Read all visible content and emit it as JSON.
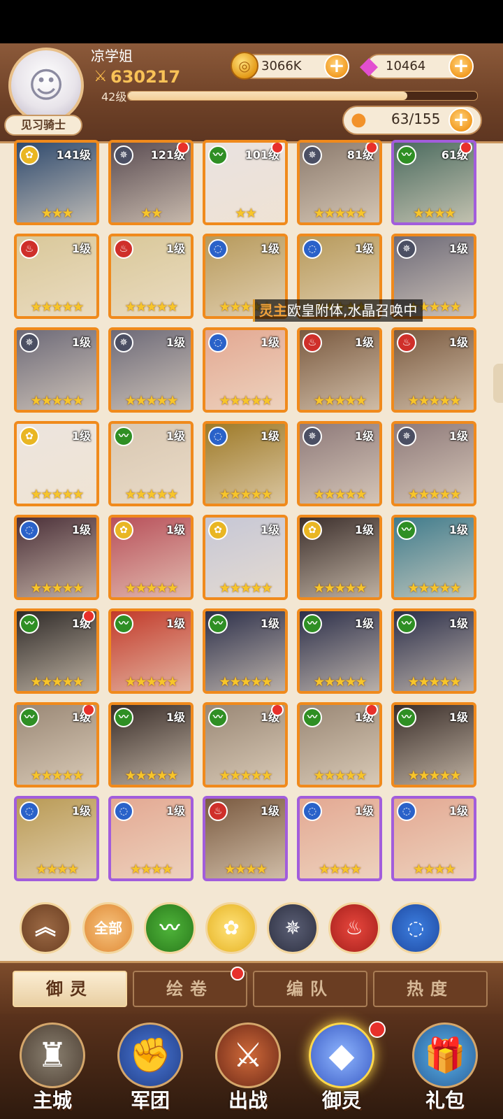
{
  "player": {
    "name": "凉学姐",
    "power": "630217",
    "level": "42级",
    "xp_fraction": 0.8,
    "rank": "见习骑士"
  },
  "resources": {
    "gold": "3066K",
    "crystals": "10464",
    "capacity": "63/155"
  },
  "element_colors": {
    "gold": "#e9b623",
    "star": "#4b4f63",
    "wind": "#2f8f24",
    "fire": "#cf2f2a",
    "water": "#2a62c9"
  },
  "heroes": [
    {
      "elem": "gold",
      "level": "141级",
      "stars": "★★★",
      "dot": false,
      "frame": "orange",
      "color": "#2f4a6e"
    },
    {
      "elem": "star",
      "level": "121级",
      "stars": "★★",
      "dot": true,
      "frame": "orange",
      "color": "#5a4c52"
    },
    {
      "elem": "wind",
      "level": "101级",
      "stars": "★★",
      "dot": true,
      "frame": "orange",
      "color": "#e9e2e0"
    },
    {
      "elem": "star",
      "level": "81级",
      "stars": "★★★★★",
      "dot": true,
      "frame": "orange",
      "color": "#8c7b6e"
    },
    {
      "elem": "wind",
      "level": "61级",
      "stars": "★★★★",
      "dot": true,
      "frame": "purple",
      "color": "#4b6b5f"
    },
    {
      "elem": "fire",
      "level": "1级",
      "stars": "★★★★★",
      "dot": false,
      "frame": "orange",
      "color": "#d9c89a"
    },
    {
      "elem": "fire",
      "level": "1级",
      "stars": "★★★★★",
      "dot": false,
      "frame": "orange",
      "color": "#d9c89a"
    },
    {
      "elem": "water",
      "level": "1级",
      "stars": "★★★★★",
      "dot": false,
      "frame": "orange",
      "color": "#b79a5c"
    },
    {
      "elem": "water",
      "level": "1级",
      "stars": "★★★★★",
      "dot": false,
      "frame": "orange",
      "color": "#b79a5c"
    },
    {
      "elem": "star",
      "level": "1级",
      "stars": "★★★★★",
      "dot": false,
      "frame": "orange",
      "color": "#6d6a78"
    },
    {
      "elem": "star",
      "level": "1级",
      "stars": "★★★★★",
      "dot": false,
      "frame": "orange",
      "color": "#6d6a78"
    },
    {
      "elem": "star",
      "level": "1级",
      "stars": "★★★★★",
      "dot": false,
      "frame": "orange",
      "color": "#6d6a78"
    },
    {
      "elem": "water",
      "level": "1级",
      "stars": "★★★★★",
      "dot": false,
      "frame": "orange",
      "color": "#e3a892"
    },
    {
      "elem": "fire",
      "level": "1级",
      "stars": "★★★★★",
      "dot": false,
      "frame": "orange",
      "color": "#7a5a40"
    },
    {
      "elem": "fire",
      "level": "1级",
      "stars": "★★★★★",
      "dot": false,
      "frame": "orange",
      "color": "#7a5a40"
    },
    {
      "elem": "gold",
      "level": "1级",
      "stars": "★★★★★",
      "dot": false,
      "frame": "orange",
      "color": "#ece4de"
    },
    {
      "elem": "wind",
      "level": "1级",
      "stars": "★★★★★",
      "dot": false,
      "frame": "orange",
      "color": "#d8c7b2"
    },
    {
      "elem": "water",
      "level": "1级",
      "stars": "★★★★★",
      "dot": false,
      "frame": "orange",
      "color": "#9e7a28"
    },
    {
      "elem": "star",
      "level": "1级",
      "stars": "★★★★★",
      "dot": false,
      "frame": "orange",
      "color": "#8e7a7a"
    },
    {
      "elem": "star",
      "level": "1级",
      "stars": "★★★★★",
      "dot": false,
      "frame": "orange",
      "color": "#8e7a7a"
    },
    {
      "elem": "water",
      "level": "1级",
      "stars": "★★★★★",
      "dot": false,
      "frame": "orange",
      "color": "#4a2f38"
    },
    {
      "elem": "gold",
      "level": "1级",
      "stars": "★★★★★",
      "dot": false,
      "frame": "orange",
      "color": "#b8505a"
    },
    {
      "elem": "gold",
      "level": "1级",
      "stars": "★★★★★",
      "dot": false,
      "frame": "orange",
      "color": "#c6c7d6"
    },
    {
      "elem": "gold",
      "level": "1级",
      "stars": "★★★★★",
      "dot": false,
      "frame": "orange",
      "color": "#3c2f2c"
    },
    {
      "elem": "wind",
      "level": "1级",
      "stars": "★★★★★",
      "dot": false,
      "frame": "orange",
      "color": "#3f7b8c"
    },
    {
      "elem": "wind",
      "level": "1级",
      "stars": "★★★★★",
      "dot": true,
      "frame": "orange",
      "color": "#2f2a28"
    },
    {
      "elem": "wind",
      "level": "1级",
      "stars": "★★★★★",
      "dot": false,
      "frame": "orange",
      "color": "#c23a2a"
    },
    {
      "elem": "wind",
      "level": "1级",
      "stars": "★★★★★",
      "dot": false,
      "frame": "orange",
      "color": "#2c2f4a"
    },
    {
      "elem": "wind",
      "level": "1级",
      "stars": "★★★★★",
      "dot": false,
      "frame": "orange",
      "color": "#2c2f4a"
    },
    {
      "elem": "wind",
      "level": "1级",
      "stars": "★★★★★",
      "dot": false,
      "frame": "orange",
      "color": "#2c2f4a"
    },
    {
      "elem": "wind",
      "level": "1级",
      "stars": "★★★★★",
      "dot": true,
      "frame": "orange",
      "color": "#9a8876"
    },
    {
      "elem": "wind",
      "level": "1级",
      "stars": "★★★★★",
      "dot": false,
      "frame": "orange",
      "color": "#3a2e2a"
    },
    {
      "elem": "wind",
      "level": "1级",
      "stars": "★★★★★",
      "dot": true,
      "frame": "orange",
      "color": "#9a8876"
    },
    {
      "elem": "wind",
      "level": "1级",
      "stars": "★★★★★",
      "dot": true,
      "frame": "orange",
      "color": "#9a8876"
    },
    {
      "elem": "wind",
      "level": "1级",
      "stars": "★★★★★",
      "dot": false,
      "frame": "orange",
      "color": "#3a2e2a"
    },
    {
      "elem": "water",
      "level": "1级",
      "stars": "★★★★",
      "dot": false,
      "frame": "purple",
      "color": "#b99a55"
    },
    {
      "elem": "water",
      "level": "1级",
      "stars": "★★★★",
      "dot": false,
      "frame": "purple",
      "color": "#e3a892"
    },
    {
      "elem": "fire",
      "level": "1级",
      "stars": "★★★★",
      "dot": false,
      "frame": "purple",
      "color": "#7a5a40"
    },
    {
      "elem": "water",
      "level": "1级",
      "stars": "★★★★",
      "dot": false,
      "frame": "purple",
      "color": "#e3a892"
    },
    {
      "elem": "water",
      "level": "1级",
      "stars": "★★★★",
      "dot": false,
      "frame": "purple",
      "color": "#e3a892"
    }
  ],
  "banner": {
    "tag": "灵主",
    "text": "欧皇附体,水晶召唤中"
  },
  "filters": {
    "collapse_icon": "double-chevron-up-icon",
    "all_label": "全部",
    "wind_icon": "wind-element-icon",
    "gold_icon": "rose-element-icon",
    "star_icon": "star-element-icon",
    "fire_icon": "fire-element-icon",
    "water_icon": "water-element-icon"
  },
  "tabs": [
    {
      "label": "御灵",
      "active": true
    },
    {
      "label": "绘卷",
      "active": false,
      "dot": true
    },
    {
      "label": "编队",
      "active": false
    },
    {
      "label": "热度",
      "active": false
    }
  ],
  "nav": [
    {
      "label": "主城",
      "icon": "castle-icon"
    },
    {
      "label": "军团",
      "icon": "fist-shield-icon"
    },
    {
      "label": "出战",
      "icon": "gate-sword-icon"
    },
    {
      "label": "御灵",
      "icon": "crystal-icon",
      "active": true,
      "dot": true
    },
    {
      "label": "礼包",
      "icon": "gift-shop-icon"
    }
  ]
}
